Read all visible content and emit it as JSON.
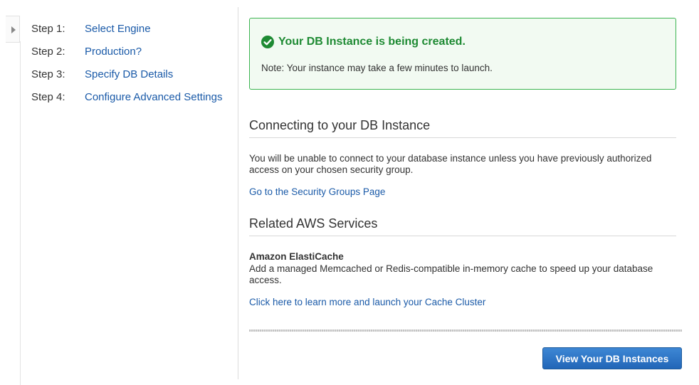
{
  "steps": [
    {
      "number": "Step 1:",
      "label": "Select Engine"
    },
    {
      "number": "Step 2:",
      "label": "Production?"
    },
    {
      "number": "Step 3:",
      "label": "Specify DB Details"
    },
    {
      "number": "Step 4:",
      "label": "Configure Advanced Settings"
    }
  ],
  "success": {
    "title": "Your DB Instance is being created.",
    "note": "Note: Your instance may take a few minutes to launch.",
    "icon": "check-circle-icon",
    "color": "#1e8a33"
  },
  "connecting": {
    "heading": "Connecting to your DB Instance",
    "body": "You will be unable to connect to your database instance unless you have previously authorized access on your chosen security group.",
    "link": "Go to the Security Groups Page"
  },
  "related": {
    "heading": "Related AWS Services",
    "service_name": "Amazon ElastiCache",
    "service_desc": "Add a managed Memcached or Redis-compatible in-memory cache to speed up your database access.",
    "link": "Click here to learn more and launch your Cache Cluster"
  },
  "actions": {
    "view_instances": "View Your DB Instances"
  },
  "colors": {
    "link": "#1a5aa8",
    "primary_button": "#2a72c6",
    "success_border": "#3cb451"
  }
}
